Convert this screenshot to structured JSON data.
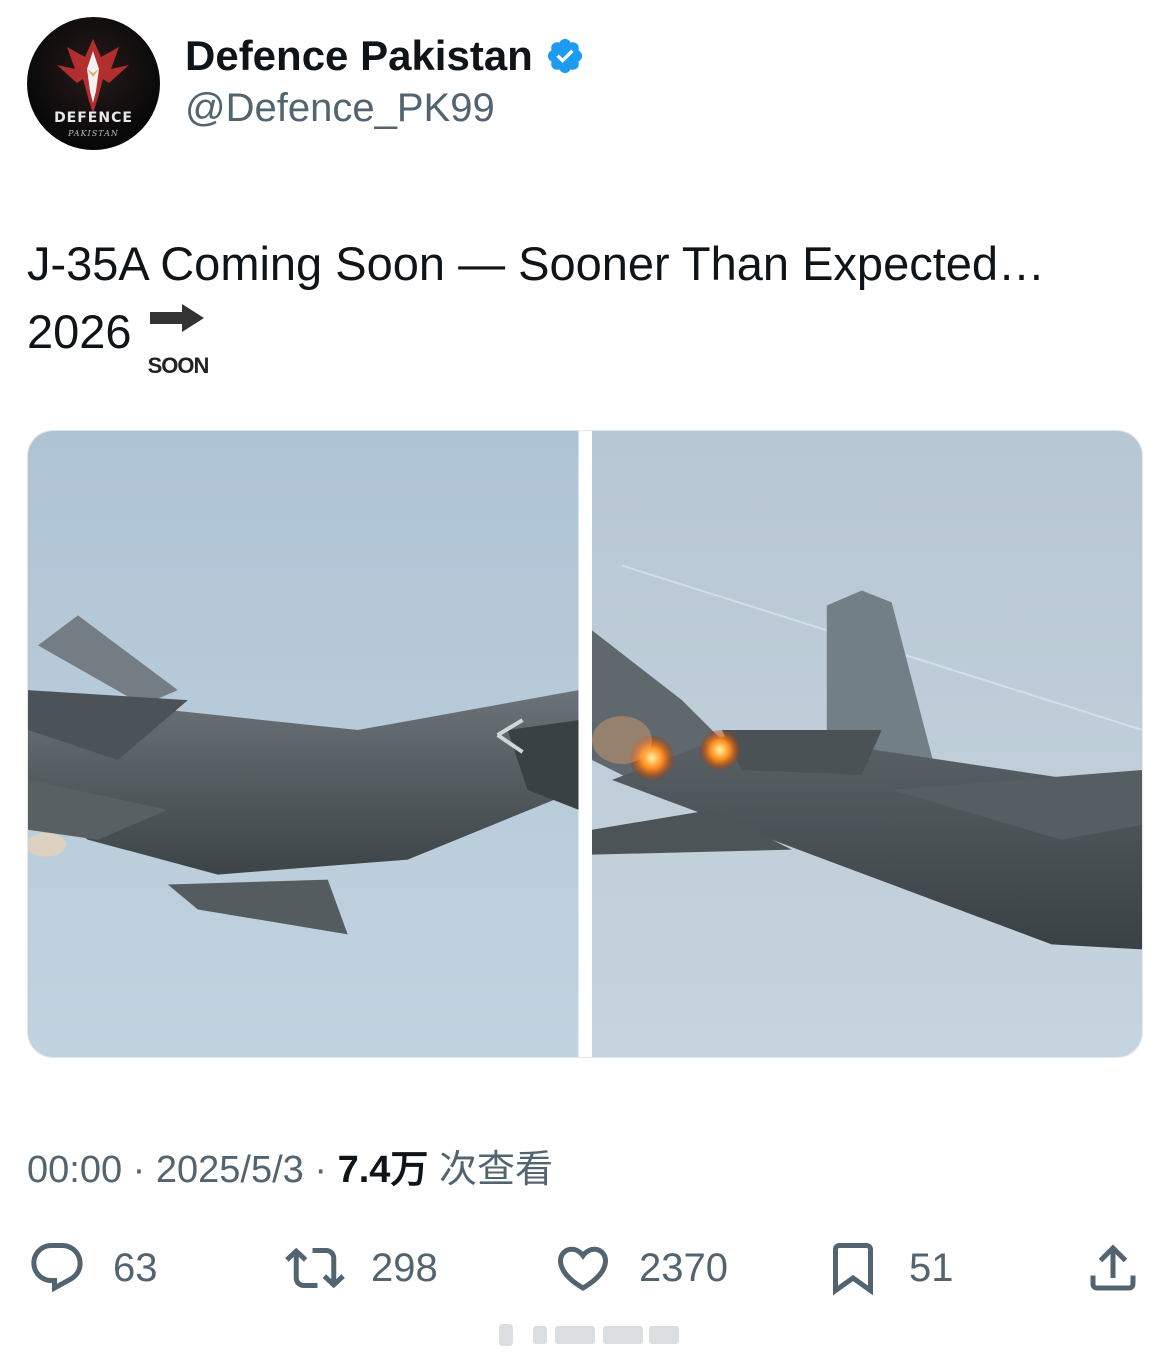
{
  "author": {
    "display_name": "Defence Pakistan",
    "handle": "@Defence_PK99",
    "verified": true,
    "avatar_icon": "eagle-logo-icon",
    "avatar_text": "DEFENCE",
    "avatar_subtext": "PAKISTAN"
  },
  "tweet": {
    "text_line1": "J-35A Coming Soon — Sooner Than Expected…",
    "text_line2": "2026",
    "emoji_label": "SOON",
    "emoji_icon": "soon-arrow-emoji"
  },
  "media": {
    "count": 2,
    "items": [
      {
        "subject": "fighter-jet-photo"
      },
      {
        "subject": "fighter-jet-photo"
      }
    ]
  },
  "meta": {
    "time": "00:00",
    "separator": " · ",
    "date": "2025/5/3",
    "views_count": "7.4万",
    "views_label": " 次查看"
  },
  "actions": {
    "replies": "63",
    "retweets": "298",
    "likes": "2370",
    "bookmarks": "51"
  },
  "colors": {
    "text_primary": "#0f1419",
    "text_secondary": "#536471",
    "verified_blue": "#1d9bf0",
    "sky": "#b4c8d8"
  }
}
